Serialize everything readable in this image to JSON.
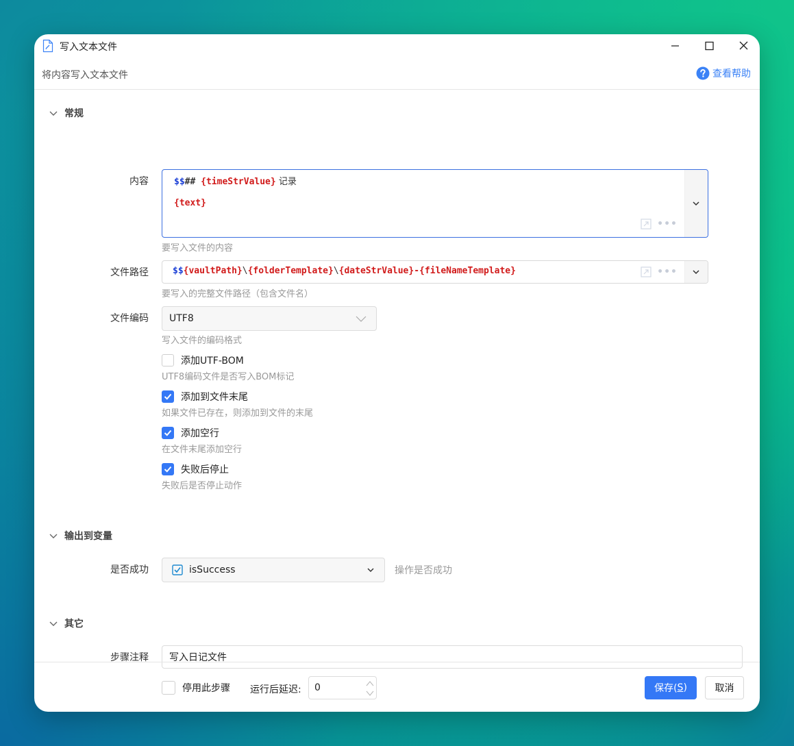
{
  "window": {
    "title": "写入文本文件",
    "subtitle": "将内容写入文本文件",
    "help_label": "查看帮助"
  },
  "sections": {
    "general": "常规",
    "output": "输出到变量",
    "other": "其它"
  },
  "fields": {
    "content": {
      "label": "内容",
      "line1": {
        "dollar": "$$",
        "hash": "## ",
        "var": "{timeStrValue}",
        "text": " 记录"
      },
      "line2": {
        "var": "{text}"
      },
      "hint": "要写入文件的内容"
    },
    "file_path": {
      "label": "文件路径",
      "dollar": "$$",
      "v1": "{vaultPath}",
      "s1": "\\",
      "v2": "{folderTemplate}",
      "s2": "\\",
      "v3": "{dateStrValue}",
      "s3": "-",
      "v4": "{fileNameTemplate}",
      "hint": "要写入的完整文件路径（包含文件名）"
    },
    "encoding": {
      "label": "文件编码",
      "value": "UTF8",
      "hint": "写入文件的编码格式"
    },
    "checkboxes": [
      {
        "label": "添加UTF-BOM",
        "hint": "UTF8编码文件是否写入BOM标记",
        "checked": false
      },
      {
        "label": "添加到文件末尾",
        "hint": "如果文件已存在，则添加到文件的末尾",
        "checked": true
      },
      {
        "label": "添加空行",
        "hint": "在文件末尾添加空行",
        "checked": true
      },
      {
        "label": "失败后停止",
        "hint": "失败后是否停止动作",
        "checked": true
      }
    ],
    "is_success": {
      "label": "是否成功",
      "value": "isSuccess",
      "hint": "操作是否成功"
    },
    "step_note": {
      "label": "步骤注释",
      "value": "写入日记文件"
    }
  },
  "footer": {
    "disable_label": "停用此步骤",
    "delay_label": "运行后延迟:",
    "delay_value": "0",
    "save_label": "保存(",
    "save_key": "S",
    "save_close": ")",
    "cancel_label": "取消"
  },
  "colors": {
    "accent": "#3478f6",
    "token_dollar": "#1b3fd6",
    "token_var": "#d11b1b"
  }
}
